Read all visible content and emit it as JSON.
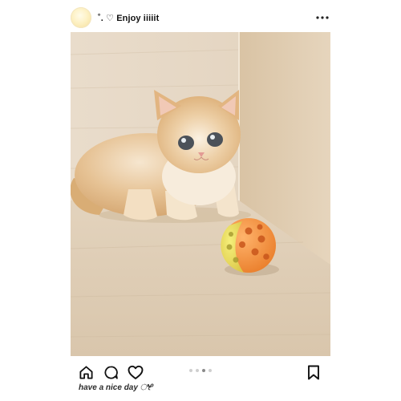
{
  "post": {
    "username": "˚. ♡ Enjoy iiiiit",
    "caption": "have a nice day ೀ⁰",
    "avatar_color": "#fdf1c4",
    "carousel": {
      "count": 4,
      "active_index": 2
    }
  },
  "icons": {
    "more": "more-horizontal-icon",
    "home": "home-icon",
    "comment": "comment-icon",
    "like": "heart-icon",
    "save": "bookmark-icon"
  }
}
